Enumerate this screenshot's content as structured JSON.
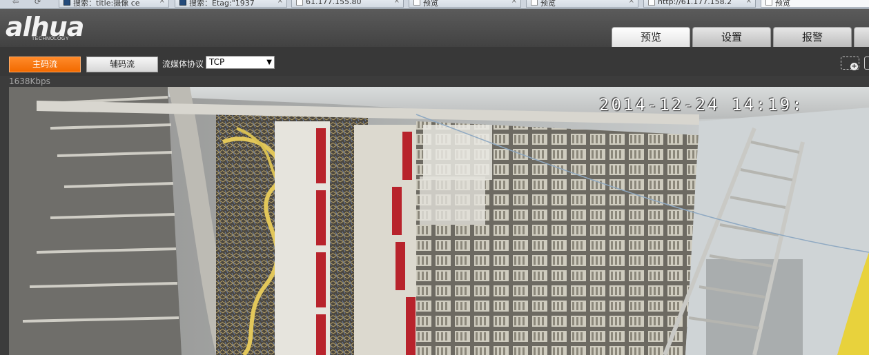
{
  "browser": {
    "nav_glyphs": "⇦  ⟳",
    "tabs": [
      {
        "title": "搜索：title:摄像 ce",
        "icon": "dark-favicon-icon"
      },
      {
        "title": "搜索：Etag:\"1937",
        "icon": "dark-favicon-icon"
      },
      {
        "title": "61.177.155.80",
        "icon": "page-icon"
      },
      {
        "title": "预览",
        "icon": "page-icon"
      },
      {
        "title": "预览",
        "icon": "page-icon"
      },
      {
        "title": "http://61.177.158.2",
        "icon": "page-icon"
      },
      {
        "title": "预览",
        "icon": "page-icon"
      }
    ],
    "close_glyph": "×"
  },
  "header": {
    "logo_text": "alhua",
    "logo_sub": "TECHNOLOGY",
    "tabs": [
      {
        "label": "预览",
        "active": true
      },
      {
        "label": "设置",
        "active": false
      },
      {
        "label": "报警",
        "active": false
      }
    ]
  },
  "toolbar": {
    "main_stream_label": "主码流",
    "sub_stream_label": "辅码流",
    "protocol_label": "流媒体协议",
    "protocol_value": "TCP",
    "accent_color": "#f26a00"
  },
  "video": {
    "bitrate": "1638Kbps",
    "osd_timestamp": "2014-12-24 14:19:"
  }
}
